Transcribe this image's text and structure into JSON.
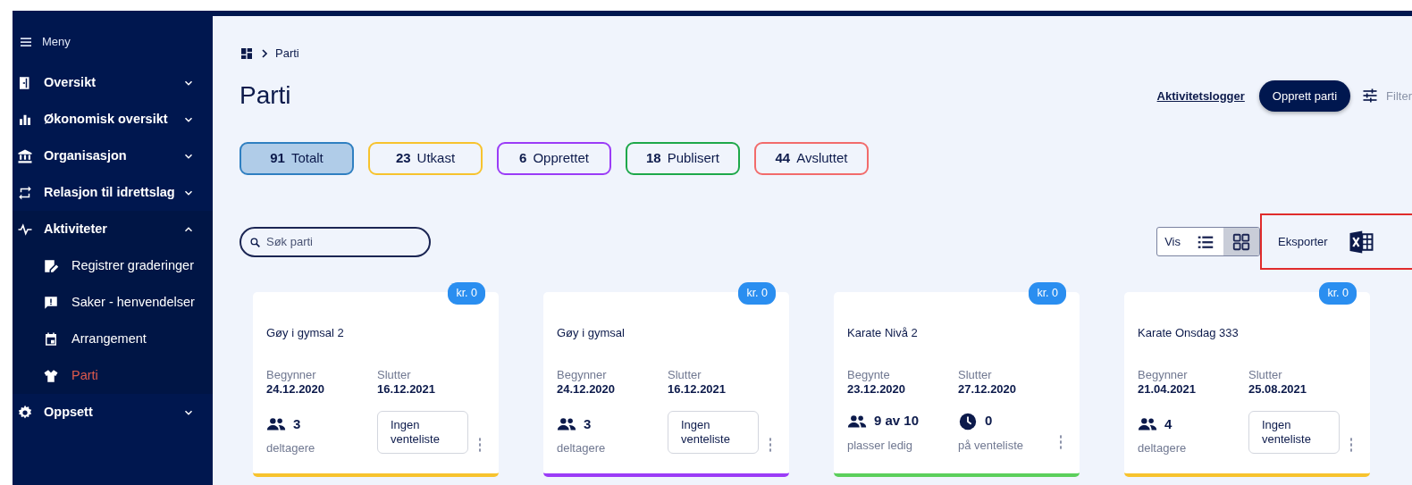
{
  "sidebar": {
    "menu_label": "Meny",
    "items": [
      {
        "label": "Oversikt",
        "expanded": false
      },
      {
        "label": "Økonomisk oversikt",
        "expanded": false
      },
      {
        "label": "Organisasjon",
        "expanded": false
      },
      {
        "label": "Relasjon til idrettslag",
        "expanded": false
      },
      {
        "label": "Aktiviteter",
        "expanded": true,
        "children": [
          {
            "label": "Registrer graderinger",
            "selected": false
          },
          {
            "label": "Saker - henvendelser",
            "selected": false
          },
          {
            "label": "Arrangement",
            "selected": false
          },
          {
            "label": "Parti",
            "selected": true
          }
        ]
      },
      {
        "label": "Oppsett",
        "expanded": false
      }
    ]
  },
  "breadcrumb": [
    "Parti"
  ],
  "title": "Parti",
  "header_actions": {
    "log_link": "Aktivitetslogger",
    "create_button": "Opprett parti",
    "filter_label": "Filter"
  },
  "status_filters": [
    {
      "count": "91",
      "label": "Totalt",
      "color": "#2f7fc1",
      "selected": true
    },
    {
      "count": "23",
      "label": "Utkast",
      "color": "#f7c32e",
      "selected": false
    },
    {
      "count": "6",
      "label": "Opprettet",
      "color": "#9b3cf7",
      "selected": false
    },
    {
      "count": "18",
      "label": "Publisert",
      "color": "#1ea84a",
      "selected": false
    },
    {
      "count": "44",
      "label": "Avsluttet",
      "color": "#f26b6b",
      "selected": false
    }
  ],
  "search": {
    "placeholder": "Søk parti"
  },
  "view_toggle": {
    "label": "Vis",
    "options": [
      {
        "kind": "list",
        "selected": false
      },
      {
        "kind": "grid",
        "selected": true
      }
    ]
  },
  "export": {
    "label": "Eksporter",
    "highlighted": true
  },
  "cards": [
    {
      "price": "kr. 0",
      "name": "Gøy i gymsal 2",
      "start_label": "Begynner",
      "start": "24.12.2020",
      "end_label": "Slutter",
      "end": "16.12.2021",
      "count": "3",
      "count_label": "deltagere",
      "kind": "waitlist_button",
      "waitlist": "Ingen venteliste",
      "color": "#f7c32e"
    },
    {
      "price": "kr. 0",
      "name": "Gøy i gymsal",
      "start_label": "Begynner",
      "start": "24.12.2020",
      "end_label": "Slutter",
      "end": "16.12.2021",
      "count": "3",
      "count_label": "deltagere",
      "kind": "waitlist_button",
      "waitlist": "Ingen venteliste",
      "color": "#9b3cf7"
    },
    {
      "price": "kr. 0",
      "name": "Karate Nivå 2",
      "start_label": "Begynte",
      "start": "23.12.2020",
      "end_label": "Slutter",
      "end": "27.12.2020",
      "count": "9 av 10",
      "count_label": "plasser ledig",
      "kind": "waitlist_count",
      "waitlist": "0",
      "waitlist_label": "på venteliste",
      "color": "#5ccf5c"
    },
    {
      "price": "kr. 0",
      "name": "Karate Onsdag 333",
      "start_label": "Begynner",
      "start": "21.04.2021",
      "end_label": "Slutter",
      "end": "25.08.2021",
      "count": "4",
      "count_label": "deltagere",
      "kind": "waitlist_button",
      "waitlist": "Ingen venteliste",
      "color": "#f7c32e"
    }
  ]
}
